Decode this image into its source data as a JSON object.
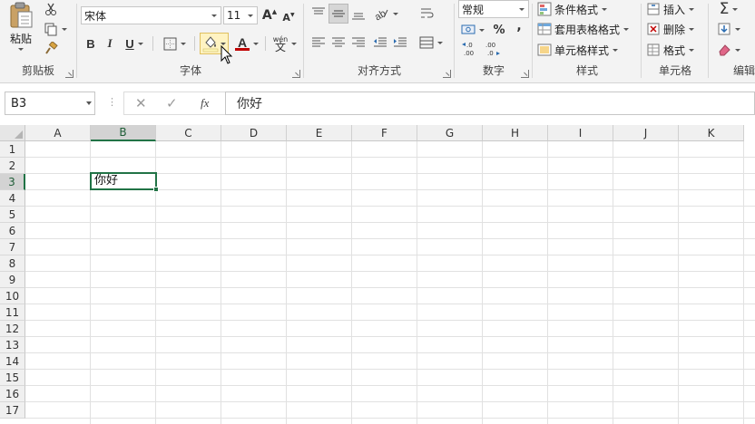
{
  "ribbon": {
    "clipboard": {
      "paste_label": "粘贴",
      "group_label": "剪贴板"
    },
    "font": {
      "group_label": "字体",
      "font_name": "宋体",
      "font_size": "11",
      "grow_label": "A",
      "shrink_label": "A",
      "bold": "B",
      "italic": "I",
      "underline": "U",
      "font_color_label": "A",
      "phonetic_label": "wén"
    },
    "alignment": {
      "group_label": "对齐方式"
    },
    "number": {
      "group_label": "数字",
      "format": "常规",
      "percent": "%",
      "comma": ",",
      "inc_decimal": "←.0\n.00",
      "dec_decimal": ".00\n→.0"
    },
    "styles": {
      "group_label": "样式",
      "conditional": "条件格式",
      "table_format": "套用表格格式",
      "cell_styles": "单元格样式"
    },
    "cells": {
      "group_label": "单元格",
      "insert": "插入",
      "delete": "删除",
      "format": "格式"
    },
    "editing": {
      "group_label": "编辑"
    }
  },
  "formula_bar": {
    "name_box": "B3",
    "fx": "fx",
    "content": "你好"
  },
  "sheet": {
    "columns": [
      "A",
      "B",
      "C",
      "D",
      "E",
      "F",
      "G",
      "H",
      "I",
      "J",
      "K"
    ],
    "rows": [
      "1",
      "2",
      "3",
      "4",
      "5",
      "6",
      "7",
      "8",
      "9",
      "10",
      "11",
      "12",
      "13",
      "14",
      "15",
      "16",
      "17"
    ],
    "selected_column": "B",
    "selected_row": "3",
    "active_cell_value": "你好"
  },
  "colors": {
    "accent": "#217346",
    "fill_highlight": "#fdf6b8",
    "font_color_bar": "#c00000"
  }
}
